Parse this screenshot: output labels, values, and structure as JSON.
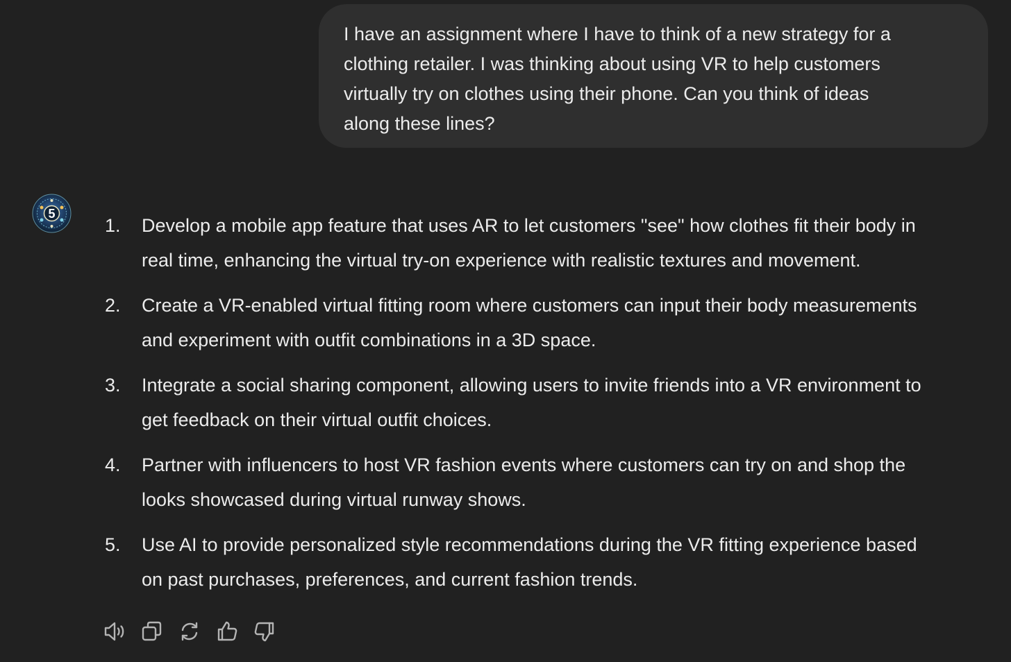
{
  "user_message": {
    "lines": [
      "I have an assignment where I have to think of a new strategy for a",
      "clothing retailer. I was thinking about using VR to help customers",
      "virtually try on clothes using their phone. Can you think of ideas",
      "along these lines?"
    ]
  },
  "assistant": {
    "avatar_label": "5",
    "items": [
      {
        "number": "1.",
        "lines": [
          "Develop a mobile app feature that uses AR to let customers \"see\" how clothes fit their body in",
          "real time, enhancing the virtual try-on experience with realistic textures and movement."
        ]
      },
      {
        "number": "2.",
        "lines": [
          "Create a VR-enabled virtual fitting room where customers can input their body measurements",
          "and experiment with outfit combinations in a 3D space."
        ]
      },
      {
        "number": "3.",
        "lines": [
          "Integrate a social sharing component, allowing users to invite friends into a VR environment to",
          "get feedback on their virtual outfit choices."
        ]
      },
      {
        "number": "4.",
        "lines": [
          "Partner with influencers to host VR fashion events where customers can try on and shop the",
          "looks showcased during virtual runway shows."
        ]
      },
      {
        "number": "5.",
        "lines": [
          "Use AI to provide personalized style recommendations during the VR fitting experience based",
          "on past purchases, preferences, and current fashion trends."
        ]
      }
    ]
  },
  "actions": [
    {
      "name": "read-aloud-button",
      "icon": "speaker-icon"
    },
    {
      "name": "copy-button",
      "icon": "copy-icon"
    },
    {
      "name": "regenerate-button",
      "icon": "refresh-icon"
    },
    {
      "name": "thumbs-up-button",
      "icon": "thumbs-up-icon"
    },
    {
      "name": "thumbs-down-button",
      "icon": "thumbs-down-icon"
    }
  ],
  "colors": {
    "background": "#212121",
    "bubble": "#2f2f2f",
    "text": "#ececec",
    "icon": "#b4b4b4"
  }
}
